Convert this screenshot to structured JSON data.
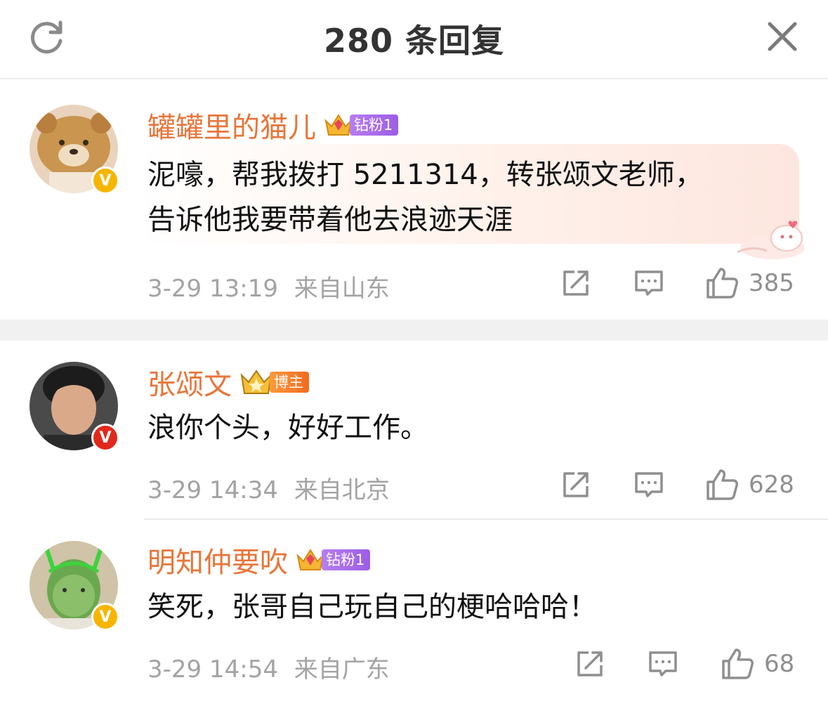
{
  "header": {
    "title": "280 条回复",
    "refresh_icon": "refresh-icon",
    "close_icon": "close-icon"
  },
  "comments": [
    {
      "username": "罐罐里的猫儿",
      "badge_label": "钻粉1",
      "verified_color": "#f7b500",
      "content_lines": [
        "泥嚎，帮我拨打 5211314，转张颂文老师，",
        "告诉他我要带着他去浪迹天涯"
      ],
      "time": "3-29 13:19",
      "location": "来自山东",
      "likes": "385"
    },
    {
      "username": "张颂文",
      "badge_label": "博主",
      "verified_color": "#e0291b",
      "content_lines": [
        "浪你个头，好好工作。"
      ],
      "time": "3-29 14:34",
      "location": "来自北京",
      "likes": "628"
    },
    {
      "username": "明知仲要吹",
      "badge_label": "钻粉1",
      "verified_color": "#f7b500",
      "content_lines": [
        "笑死，张哥自己玩自己的梗哈哈哈！"
      ],
      "time": "3-29 14:54",
      "location": "来自广东",
      "likes": "68"
    }
  ],
  "colors": {
    "username": "#e8753a",
    "meta": "#a3a3a3",
    "verified_yellow": "#f7b500",
    "verified_red": "#e0291b"
  }
}
